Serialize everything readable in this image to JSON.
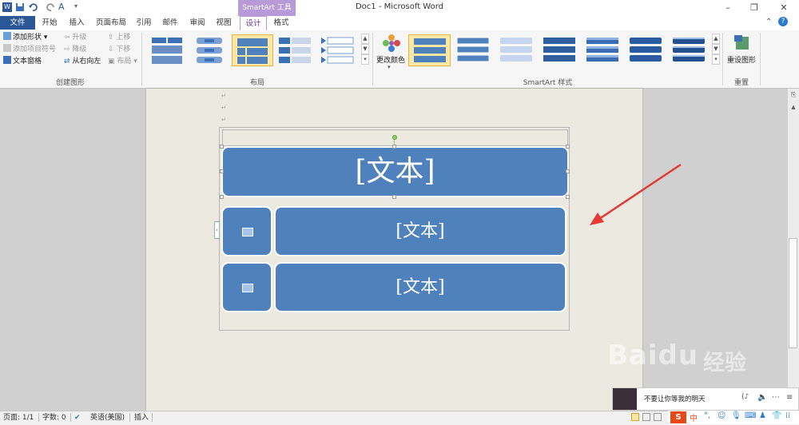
{
  "window": {
    "title": "Doc1 - Microsoft Word",
    "contextual_tab_group": "SmartArt 工具"
  },
  "tabs": [
    {
      "label": "文件"
    },
    {
      "label": "开始"
    },
    {
      "label": "插入"
    },
    {
      "label": "页面布局"
    },
    {
      "label": "引用"
    },
    {
      "label": "邮件"
    },
    {
      "label": "审阅"
    },
    {
      "label": "视图"
    },
    {
      "label": "设计"
    },
    {
      "label": "格式"
    }
  ],
  "ribbon": {
    "create_graphic": {
      "label": "创建图形",
      "add_shape": "添加形状",
      "add_bullet": "添加项目符号",
      "text_pane": "文本窗格",
      "promote": "升级",
      "demote": "降级",
      "right_to_left": "从右向左",
      "move_up": "上移",
      "move_down": "下移",
      "layout_btn": "布局"
    },
    "layouts": {
      "label": "布局"
    },
    "styles": {
      "label": "SmartArt 样式",
      "change_colors": "更改颜色"
    },
    "reset": {
      "label": "重置",
      "reset_graphic": "重设图形"
    }
  },
  "document": {
    "smartart": {
      "main_text": "[文本]",
      "row1_text": "[文本]",
      "row2_text": "[文本]"
    }
  },
  "status": {
    "page": "页面: 1/1",
    "words": "字数: 0",
    "language": "英语(美国)",
    "mode": "插入"
  },
  "popup": {
    "title_text": "不要让你等我的明天"
  },
  "watermark": {
    "brand": "Baidu",
    "sub": "经验"
  },
  "colors": {
    "accent": "#2b5797",
    "smartart_fill": "#4f81bd",
    "contextual": "#b99ad9",
    "annotation_arrow": "#e53935"
  }
}
